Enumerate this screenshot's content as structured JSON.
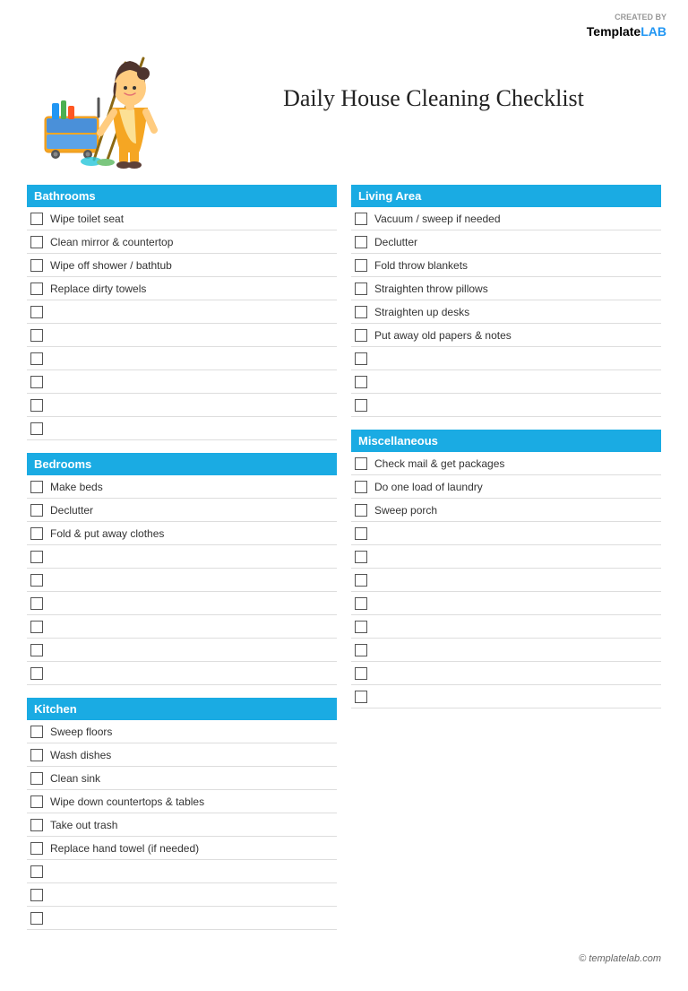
{
  "logo": {
    "created_by": "CREATED BY",
    "template": "Template",
    "lab": "LAB"
  },
  "title": "Daily House Cleaning Checklist",
  "sections": [
    {
      "id": "bathrooms",
      "label": "Bathrooms",
      "column": 0,
      "items": [
        "Wipe toilet seat",
        "Clean mirror & countertop",
        "Wipe off shower / bathtub",
        "Replace dirty towels",
        "",
        "",
        "",
        "",
        "",
        ""
      ]
    },
    {
      "id": "living-area",
      "label": "Living Area",
      "column": 1,
      "items": [
        "Vacuum / sweep if needed",
        "Declutter",
        "Fold throw blankets",
        "Straighten throw pillows",
        "Straighten up desks",
        "Put away old papers & notes",
        "",
        "",
        ""
      ]
    },
    {
      "id": "bedrooms",
      "label": "Bedrooms",
      "column": 0,
      "items": [
        "Make beds",
        "Declutter",
        "Fold & put away clothes",
        "",
        "",
        "",
        "",
        "",
        ""
      ]
    },
    {
      "id": "miscellaneous",
      "label": "Miscellaneous",
      "column": 1,
      "items": [
        "Check mail & get packages",
        "Do one load of laundry",
        "Sweep porch",
        "",
        "",
        "",
        "",
        "",
        "",
        "",
        ""
      ]
    },
    {
      "id": "kitchen",
      "label": "Kitchen",
      "column": 0,
      "items": [
        "Sweep floors",
        "Wash dishes",
        "Clean sink",
        "Wipe down countertops & tables",
        "Take out trash",
        "Replace hand towel (if needed)",
        "",
        "",
        ""
      ]
    }
  ],
  "footer": "© templatelab.com"
}
